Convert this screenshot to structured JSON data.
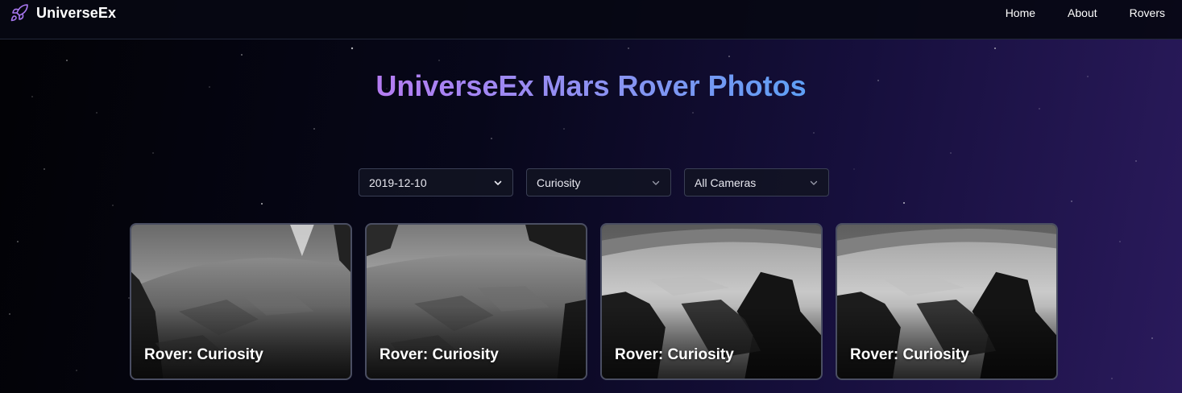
{
  "brand": {
    "name": "UniverseEx",
    "logo_icon": "rocket-icon",
    "logo_color": "#a877f0"
  },
  "nav": {
    "links": [
      "Home",
      "About",
      "Rovers"
    ]
  },
  "hero": {
    "title": "UniverseEx Mars Rover Photos"
  },
  "filters": {
    "date": {
      "value": "2019-12-10",
      "icon": "chevron-down-icon"
    },
    "rover": {
      "value": "Curiosity",
      "icon": "chevron-down-icon"
    },
    "camera": {
      "value": "All Cameras",
      "icon": "chevron-down-icon"
    }
  },
  "photos": [
    {
      "label": "Rover: Curiosity"
    },
    {
      "label": "Rover: Curiosity"
    },
    {
      "label": "Rover: Curiosity"
    },
    {
      "label": "Rover: Curiosity"
    }
  ],
  "colors": {
    "title_gradient_start": "#b57cf2",
    "title_gradient_end": "#5e9ff5",
    "background_dark": "#020205",
    "background_purple": "#2a1a5c"
  }
}
